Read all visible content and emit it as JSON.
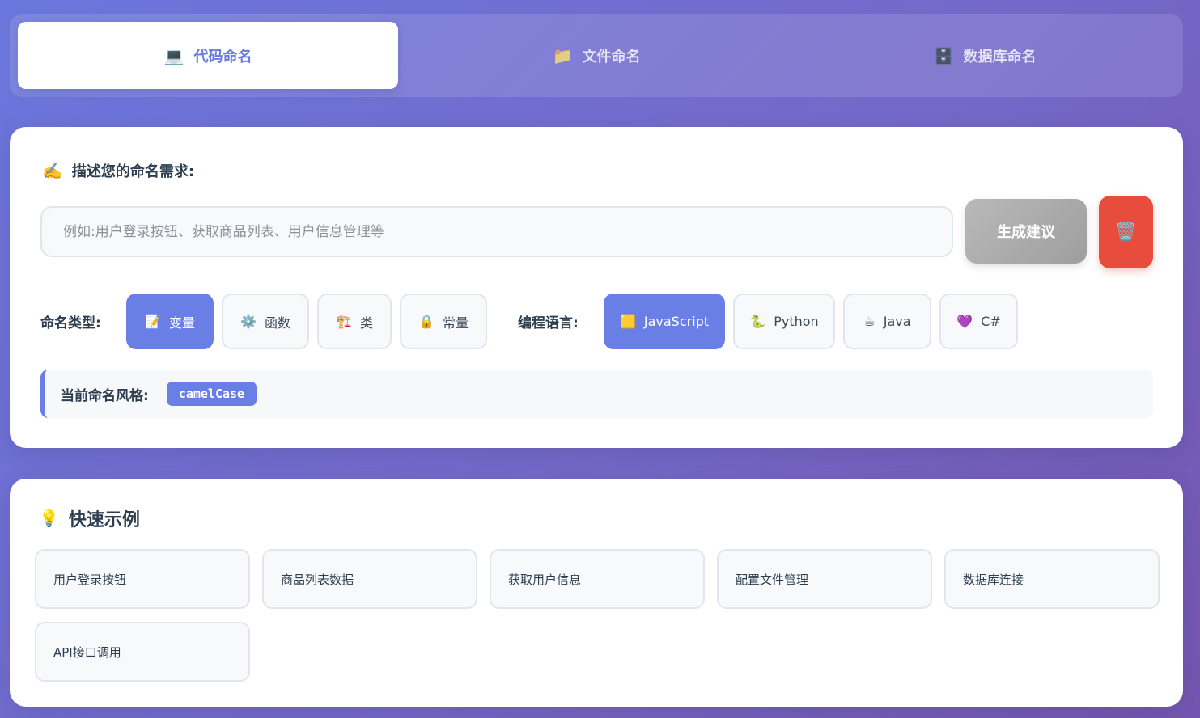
{
  "tabs": [
    {
      "icon": "💻",
      "label": "代码命名",
      "active": true
    },
    {
      "icon": "📁",
      "label": "文件命名",
      "active": false
    },
    {
      "icon": "🗄️",
      "label": "数据库命名",
      "active": false
    }
  ],
  "input_section": {
    "icon": "✍️",
    "label": "描述您的命名需求:",
    "input_value": "",
    "input_placeholder": "例如:用户登录按钮、获取商品列表、用户信息管理等",
    "generate_label": "生成建议",
    "clear_icon": "🗑️"
  },
  "naming_type": {
    "label": "命名类型:",
    "options": [
      {
        "icon": "📝",
        "label": "变量",
        "active": true
      },
      {
        "icon": "⚙️",
        "label": "函数",
        "active": false
      },
      {
        "icon": "🏗️",
        "label": "类",
        "active": false
      },
      {
        "icon": "🔒",
        "label": "常量",
        "active": false
      }
    ]
  },
  "language": {
    "label": "编程语言:",
    "options": [
      {
        "icon": "🟨",
        "label": "JavaScript",
        "active": true
      },
      {
        "icon": "🐍",
        "label": "Python",
        "active": false
      },
      {
        "icon": "☕",
        "label": "Java",
        "active": false
      },
      {
        "icon": "💜",
        "label": "C#",
        "active": false
      }
    ]
  },
  "current_style": {
    "label": "当前命名风格:",
    "value": "camelCase"
  },
  "quick_examples": {
    "icon": "💡",
    "title": "快速示例",
    "items": [
      "用户登录按钮",
      "商品列表数据",
      "获取用户信息",
      "配置文件管理",
      "数据库连接",
      "API接口调用"
    ]
  },
  "colors": {
    "accent": "#6a7fe6",
    "danger": "#e84c3d",
    "generate_disabled": "#a8a8a8"
  }
}
